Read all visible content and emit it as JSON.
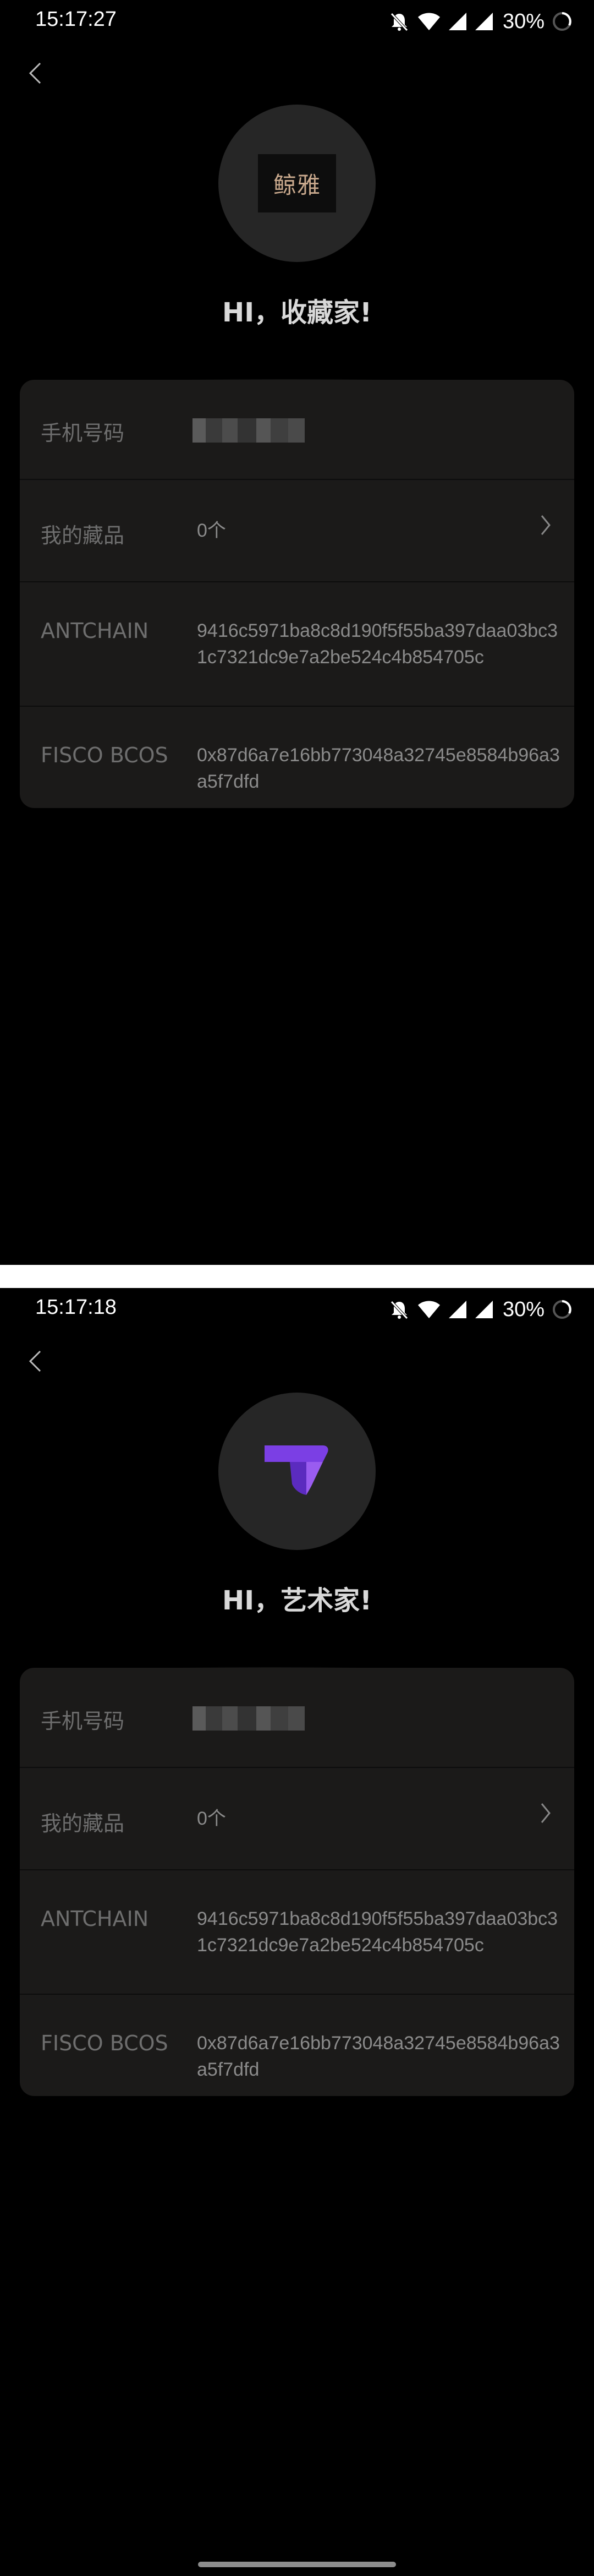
{
  "screens": [
    {
      "status": {
        "time": "15:17:27",
        "battery": "30%"
      },
      "greeting": "HI，收藏家!",
      "logo": {
        "type": "text",
        "text": "鲸雅"
      },
      "rows": {
        "phone": {
          "label": "手机号码",
          "value": ""
        },
        "collection": {
          "label": "我的藏品",
          "value": "0个"
        },
        "antchain": {
          "label": "ANTCHAIN",
          "value": "9416c5971ba8c8d190f5f55ba397daa03bc31c7321dc9e7a2be524c4b854705c"
        },
        "fisco": {
          "label": "FISCO BCOS",
          "value": "0x87d6a7e16bb773048a32745e8584b96a3a5f7dfd"
        }
      }
    },
    {
      "status": {
        "time": "15:17:18",
        "battery": "30%"
      },
      "greeting": "HI，艺术家!",
      "logo": {
        "type": "icon",
        "icon": "purple-t-logo-icon",
        "color": "#7b3fe4"
      },
      "rows": {
        "phone": {
          "label": "手机号码",
          "value": ""
        },
        "collection": {
          "label": "我的藏品",
          "value": "0个"
        },
        "antchain": {
          "label": "ANTCHAIN",
          "value": "9416c5971ba8c8d190f5f55ba397daa03bc31c7321dc9e7a2be524c4b854705c"
        },
        "fisco": {
          "label": "FISCO BCOS",
          "value": "0x87d6a7e16bb773048a32745e8584b96a3a5f7dfd"
        }
      }
    }
  ],
  "colors": {
    "background": "#000000",
    "card": "#1b1a19",
    "label": "#6e6e6e",
    "value": "#8b8b8b",
    "accent": "#7b3fe4"
  }
}
